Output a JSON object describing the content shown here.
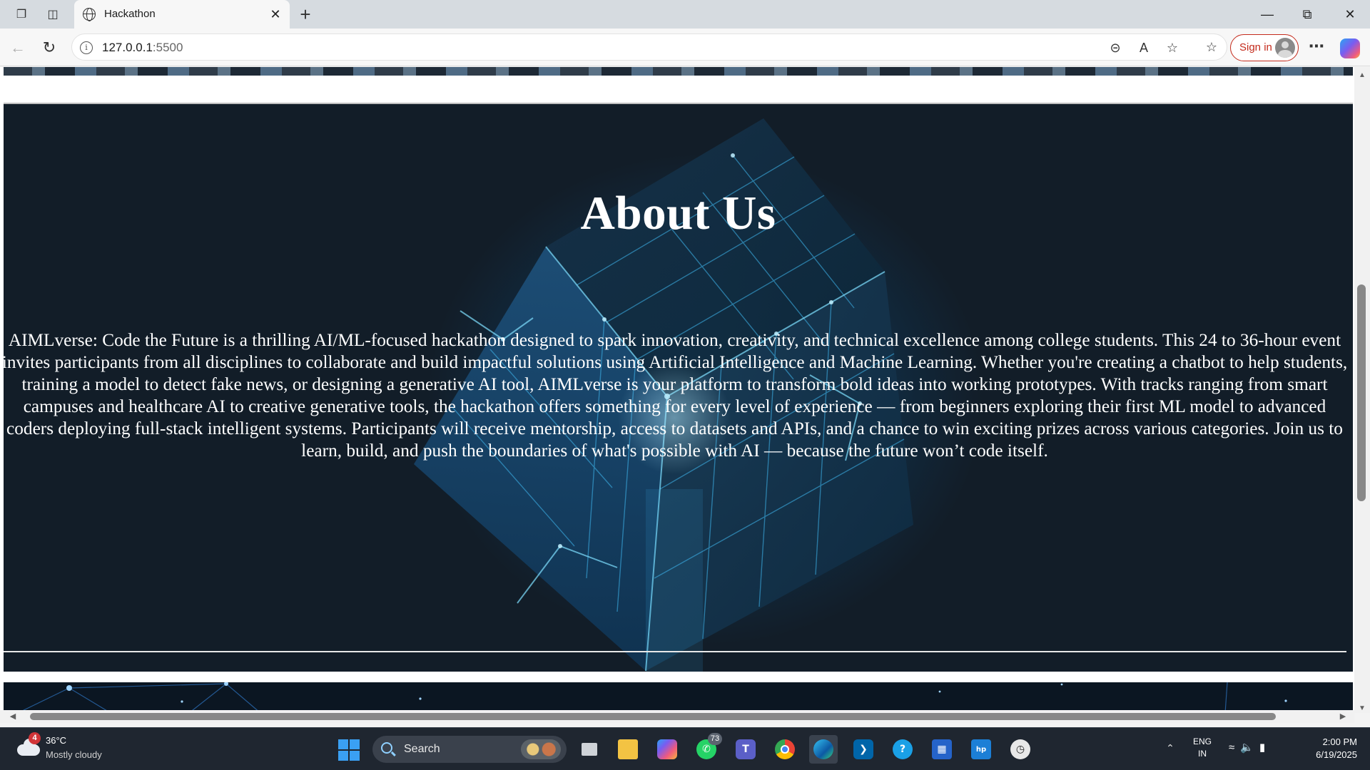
{
  "browser": {
    "tab_title": "Hackathon",
    "url_host": "127.0.0.1",
    "url_port": ":5500",
    "sign_in_label": "Sign in"
  },
  "page": {
    "about_title": "About Us",
    "about_text": "AIMLverse: Code the Future is a thrilling AI/ML-focused hackathon designed to spark innovation, creativity, and technical excellence among college students. This 24 to 36-hour event invites participants from all disciplines to collaborate and build impactful solutions using Artificial Intelligence and Machine Learning. Whether you're creating a chatbot to help students, training a model to detect fake news, or designing a generative AI tool, AIMLverse is your platform to transform bold ideas into working prototypes. With tracks ranging from smart campuses and healthcare AI to creative generative tools, the hackathon offers something for every level of experience — from beginners exploring their first ML model to advanced coders deploying full-stack intelligent systems. Participants will receive mentorship, access to datasets and APIs, and a chance to win exciting prizes across various categories. Join us to learn, build, and push the boundaries of what's possible with AI — because the future won’t code itself.",
    "colors": {
      "section_bg": "#121d28",
      "accent_glow": "#1ea0e6",
      "text": "#ffffff"
    }
  },
  "taskbar": {
    "weather_badge": "4",
    "weather_temp": "36°C",
    "weather_desc": "Mostly cloudy",
    "search_label": "Search",
    "whatsapp_badge": "73",
    "lang_line1": "ENG",
    "lang_line2": "IN",
    "time": "2:00 PM",
    "date": "6/19/2025"
  }
}
